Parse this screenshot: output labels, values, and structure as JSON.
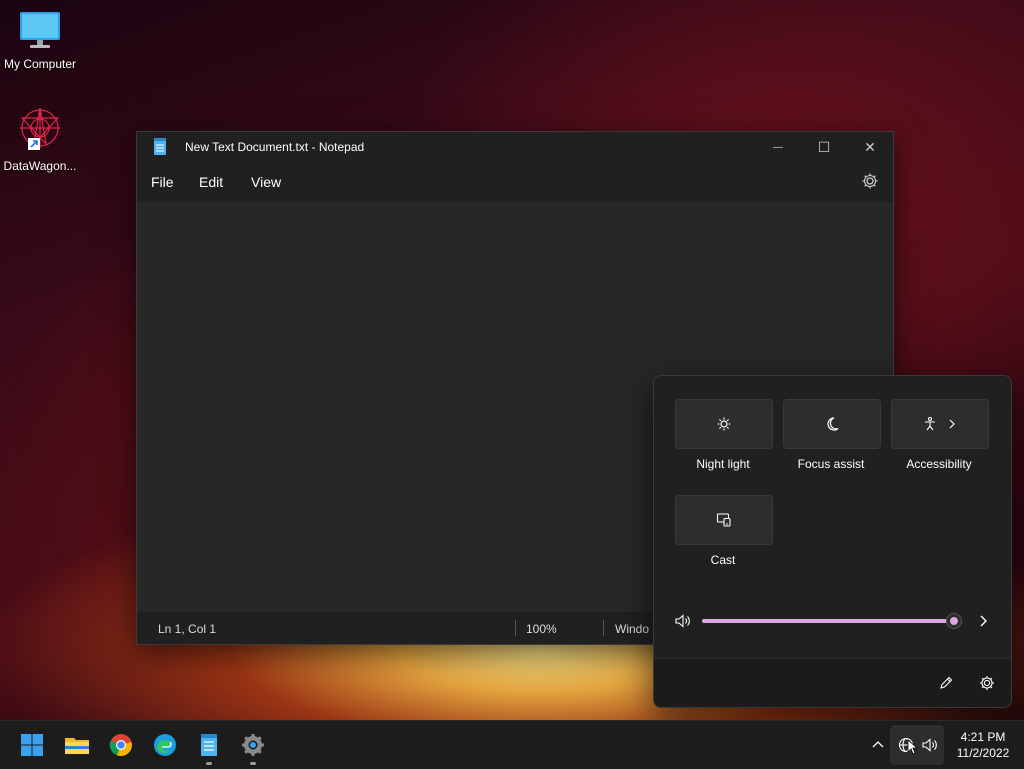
{
  "desktop": {
    "icons": [
      {
        "label": "My Computer"
      },
      {
        "label": "DataWagon..."
      }
    ]
  },
  "notepad": {
    "title": "New Text Document.txt - Notepad",
    "menu": [
      "File",
      "Edit",
      "View"
    ],
    "controls": {
      "minimize": "—",
      "maximize": "☐",
      "close": "✕"
    },
    "status": {
      "position": "Ln 1, Col 1",
      "zoom": "100%",
      "line_ending": "Windo"
    }
  },
  "quick_settings": {
    "tiles": [
      {
        "label": "Night light",
        "icon": "night-light-icon"
      },
      {
        "label": "Focus assist",
        "icon": "moon-icon"
      },
      {
        "label": "Accessibility",
        "icon": "accessibility-icon"
      },
      {
        "label": "Cast",
        "icon": "cast-icon"
      }
    ],
    "volume": {
      "level": 1.0
    },
    "accent_color": "#dba7e0"
  },
  "taskbar": {
    "apps": [
      "start-icon",
      "file-explorer-icon",
      "chrome-icon",
      "edge-icon",
      "notepad-icon",
      "settings-icon"
    ],
    "clock": {
      "time": "4:21 PM",
      "date": "11/2/2022"
    }
  }
}
